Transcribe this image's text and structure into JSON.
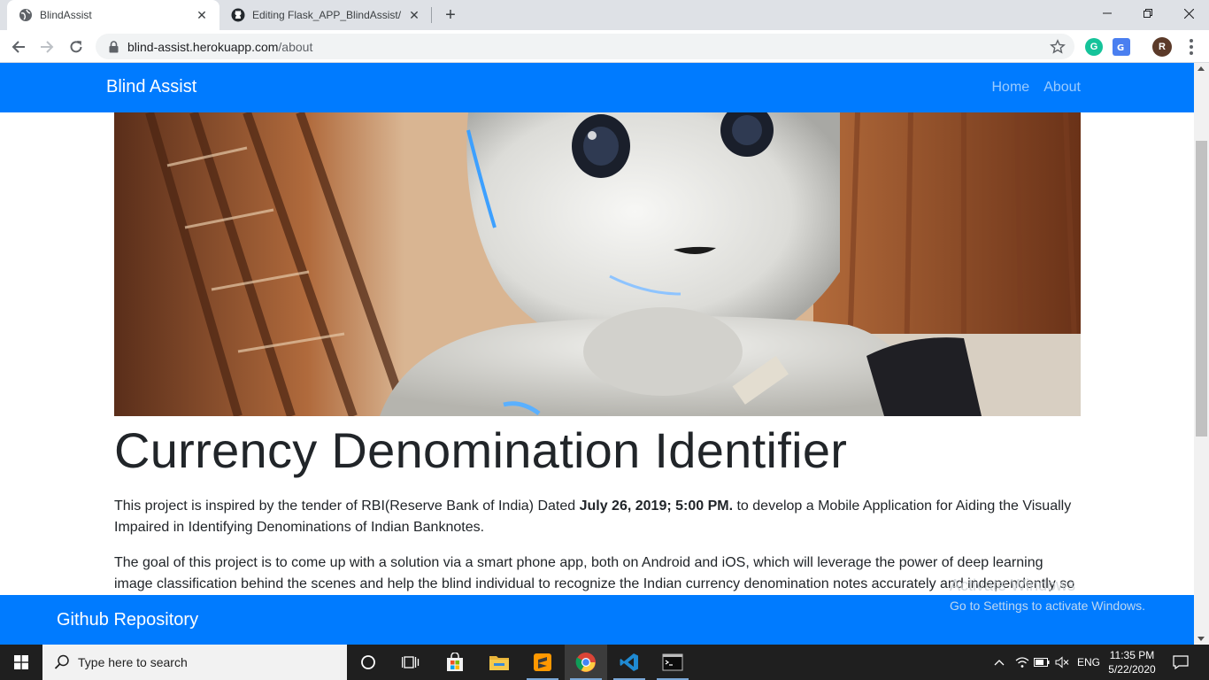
{
  "browser": {
    "tabs": [
      {
        "title": "BlindAssist",
        "active": true
      },
      {
        "title": "Editing Flask_APP_BlindAssist/READ",
        "active": false
      }
    ],
    "url_host": "blind-assist.herokuapp.com",
    "url_path": "/about",
    "profile_initial": "R"
  },
  "site": {
    "brand": "Blind Assist",
    "nav": {
      "home": "Home",
      "about": "About"
    },
    "heading": "Currency Denomination Identifier",
    "p1_before": "This project is inspired by the tender of RBI(Reserve Bank of India) Dated ",
    "p1_bold": "July 26, 2019; 5:00 PM.",
    "p1_after": " to develop a Mobile Application for Aiding the Visually Impaired in Identifying Denominations of Indian Banknotes.",
    "p2": "The goal of this project is to come up with a solution via a smart phone app, both on Android and iOS, which will leverage the power of deep learning image classification behind the scenes and help the blind individual to recognize the Indian currency denomination notes accurately and independently so",
    "footer_link": "Github Repository"
  },
  "watermark": {
    "line1": "Activate Windows",
    "line2": "Go to Settings to activate Windows."
  },
  "taskbar": {
    "search_placeholder": "Type here to search",
    "lang": "ENG",
    "time": "11:35 PM",
    "date": "5/22/2020"
  },
  "colors": {
    "primary": "#007bff",
    "text": "#212529",
    "taskbar": "#1f1f1f"
  }
}
